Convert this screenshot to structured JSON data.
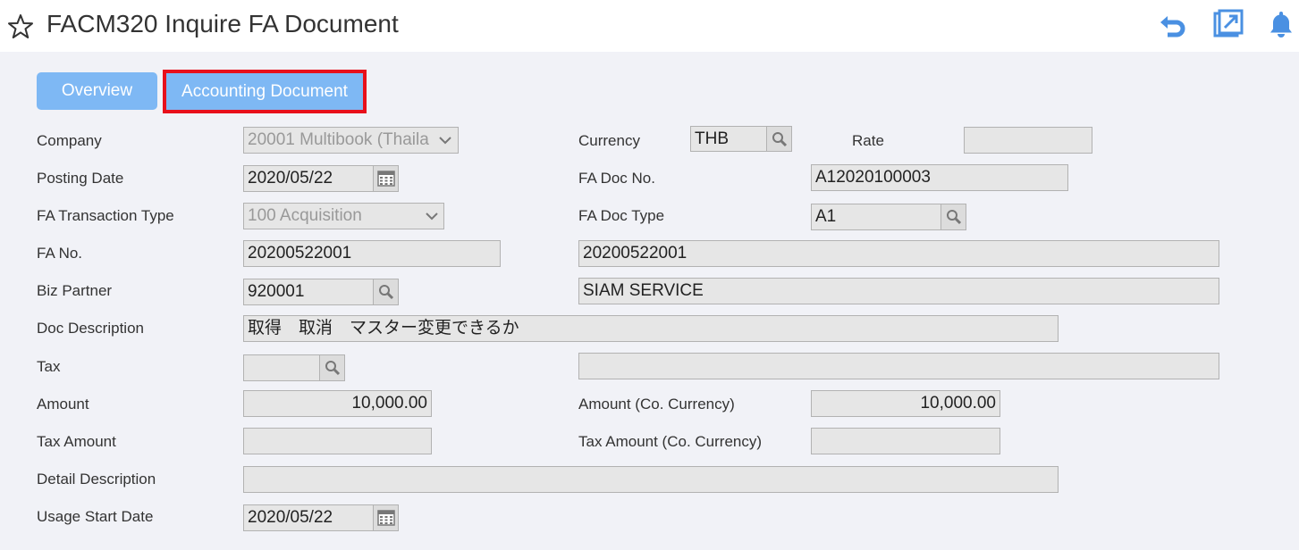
{
  "header": {
    "title": "FACM320 Inquire FA Document",
    "icons": [
      "star-icon",
      "undo-icon",
      "popout-icon",
      "bell-icon"
    ],
    "accent_color": "#7eb8f4"
  },
  "tabs": {
    "overview": "Overview",
    "accounting_document": "Accounting Document",
    "highlight_color": "#e8101b"
  },
  "form": {
    "company_label": "Company",
    "company_value": "20001 Multibook (Thaila",
    "currency_label": "Currency",
    "currency_value": "THB",
    "rate_label": "Rate",
    "rate_value": "",
    "posting_date_label": "Posting Date",
    "posting_date_value": "2020/05/22",
    "fa_doc_no_label": "FA Doc No.",
    "fa_doc_no_value": "A12020100003",
    "fa_txn_type_label": "FA Transaction Type",
    "fa_txn_type_value": "100 Acquisition",
    "fa_doc_type_label": "FA Doc Type",
    "fa_doc_type_value": "A1",
    "fa_no_label": "FA No.",
    "fa_no_value": "20200522001",
    "fa_no_name": "20200522001",
    "biz_partner_label": "Biz Partner",
    "biz_partner_value": "920001",
    "biz_partner_name": "SIAM SERVICE",
    "doc_desc_label": "Doc Description",
    "doc_desc_value": "取得　取消　マスター変更できるか",
    "tax_label": "Tax",
    "tax_value": "",
    "tax_name": "",
    "amount_label": "Amount",
    "amount_value": "10,000.00",
    "amount_co_label": "Amount (Co. Currency)",
    "amount_co_value": "10,000.00",
    "tax_amount_label": "Tax Amount",
    "tax_amount_value": "",
    "tax_amount_co_label": "Tax Amount (Co. Currency)",
    "tax_amount_co_value": "",
    "detail_desc_label": "Detail Description",
    "detail_desc_value": "",
    "usage_start_label": "Usage Start Date",
    "usage_start_value": "2020/05/22"
  }
}
